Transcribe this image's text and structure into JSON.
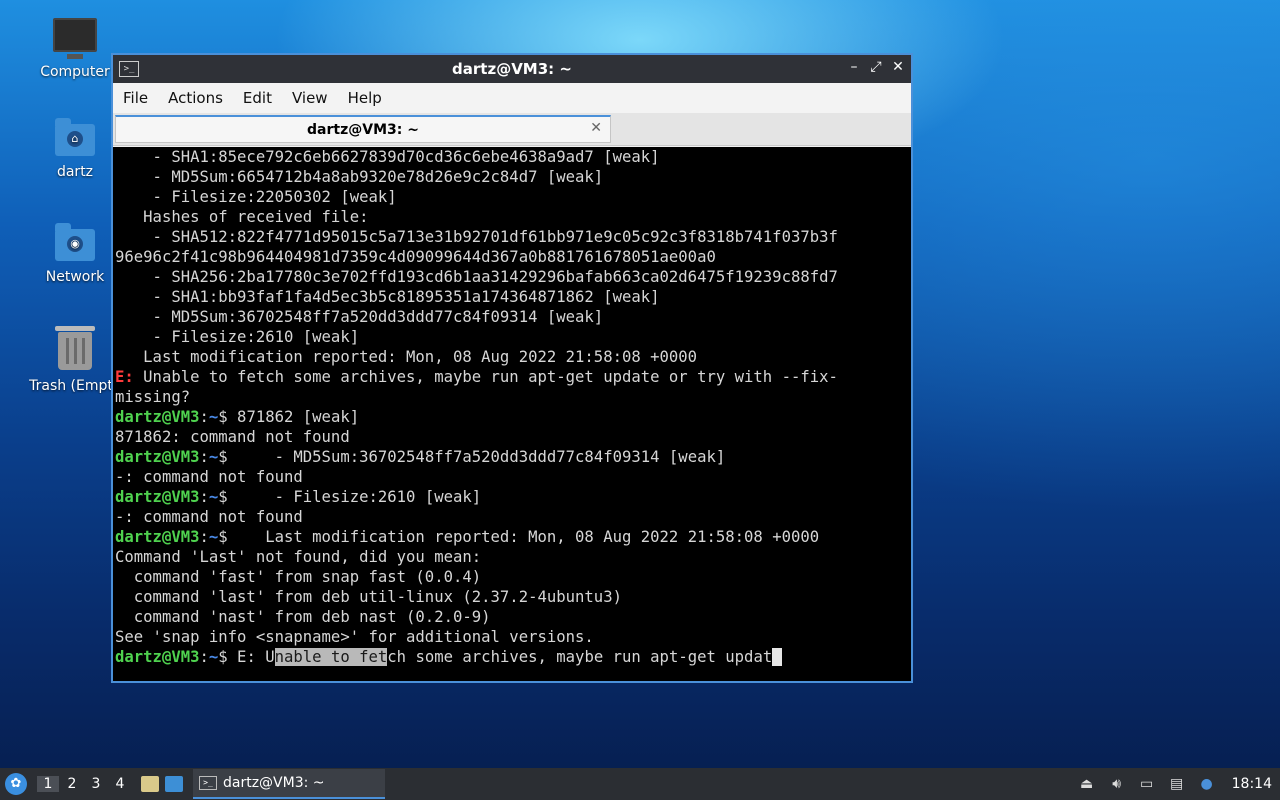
{
  "desktop": {
    "icons": [
      {
        "label": "Computer"
      },
      {
        "label": "dartz"
      },
      {
        "label": "Network"
      },
      {
        "label": "Trash (Empt"
      }
    ]
  },
  "window": {
    "title": "dartz@VM3: ~",
    "menu": [
      "File",
      "Actions",
      "Edit",
      "View",
      "Help"
    ],
    "tab_label": "dartz@VM3: ~",
    "controls": {
      "minimize": "–",
      "maximize": "⤢",
      "close": "✕"
    }
  },
  "terminal": {
    "prompt_user": "dartz@VM3",
    "prompt_sep": ":",
    "prompt_path": "~",
    "prompt_dollar": "$",
    "error_tag": "E:",
    "lines": [
      "    - SHA1:85ece792c6eb6627839d70cd36c6ebe4638a9ad7 [weak]",
      "    - MD5Sum:6654712b4a8ab9320e78d26e9c2c84d7 [weak]",
      "    - Filesize:22050302 [weak]",
      "   Hashes of received file:",
      "    - SHA512:822f4771d95015c5a713e31b92701df61bb971e9c05c92c3f8318b741f037b3f",
      "96e96c2f41c98b964404981d7359c4d09099644d367a0b881761678051ae00a0",
      "    - SHA256:2ba17780c3e702ffd193cd6b1aa31429296bafab663ca02d6475f19239c88fd7",
      "    - SHA1:bb93faf1fa4d5ec3b5c81895351a174364871862 [weak]",
      "    - MD5Sum:36702548ff7a520dd3ddd77c84f09314 [weak]",
      "    - Filesize:2610 [weak]",
      "   Last modification reported: Mon, 08 Aug 2022 21:58:08 +0000"
    ],
    "error_line_1": " Unable to fetch some archives, maybe run apt-get update or try with --fix-",
    "error_line_2": "missing?",
    "cmd1": " 871862 [weak]",
    "out1": "871862: command not found",
    "cmd2": "     - MD5Sum:36702548ff7a520dd3ddd77c84f09314 [weak]",
    "out2": "-: command not found",
    "cmd3": "     - Filesize:2610 [weak]",
    "out3": "-: command not found",
    "cmd4": "    Last modification reported: Mon, 08 Aug 2022 21:58:08 +0000",
    "out4": [
      "Command 'Last' not found, did you mean:",
      "  command 'fast' from snap fast (0.0.4)",
      "  command 'last' from deb util-linux (2.37.2-4ubuntu3)",
      "  command 'nast' from deb nast (0.2.0-9)",
      "See 'snap info <snapname>' for additional versions."
    ],
    "current_input_before": " E: U",
    "current_input_selected": "nable to fet",
    "current_input_after": "ch some archives, maybe run apt-get updat"
  },
  "taskbar": {
    "workspaces": [
      "1",
      "2",
      "3",
      "4"
    ],
    "active_workspace": "1",
    "task_label": "dartz@VM3: ~",
    "clock": "18:14"
  },
  "colors": {
    "prompt_user": "#4fd24f",
    "prompt_path": "#4a8ae8",
    "error": "#ff3b3b",
    "accent": "#4a90d9"
  }
}
